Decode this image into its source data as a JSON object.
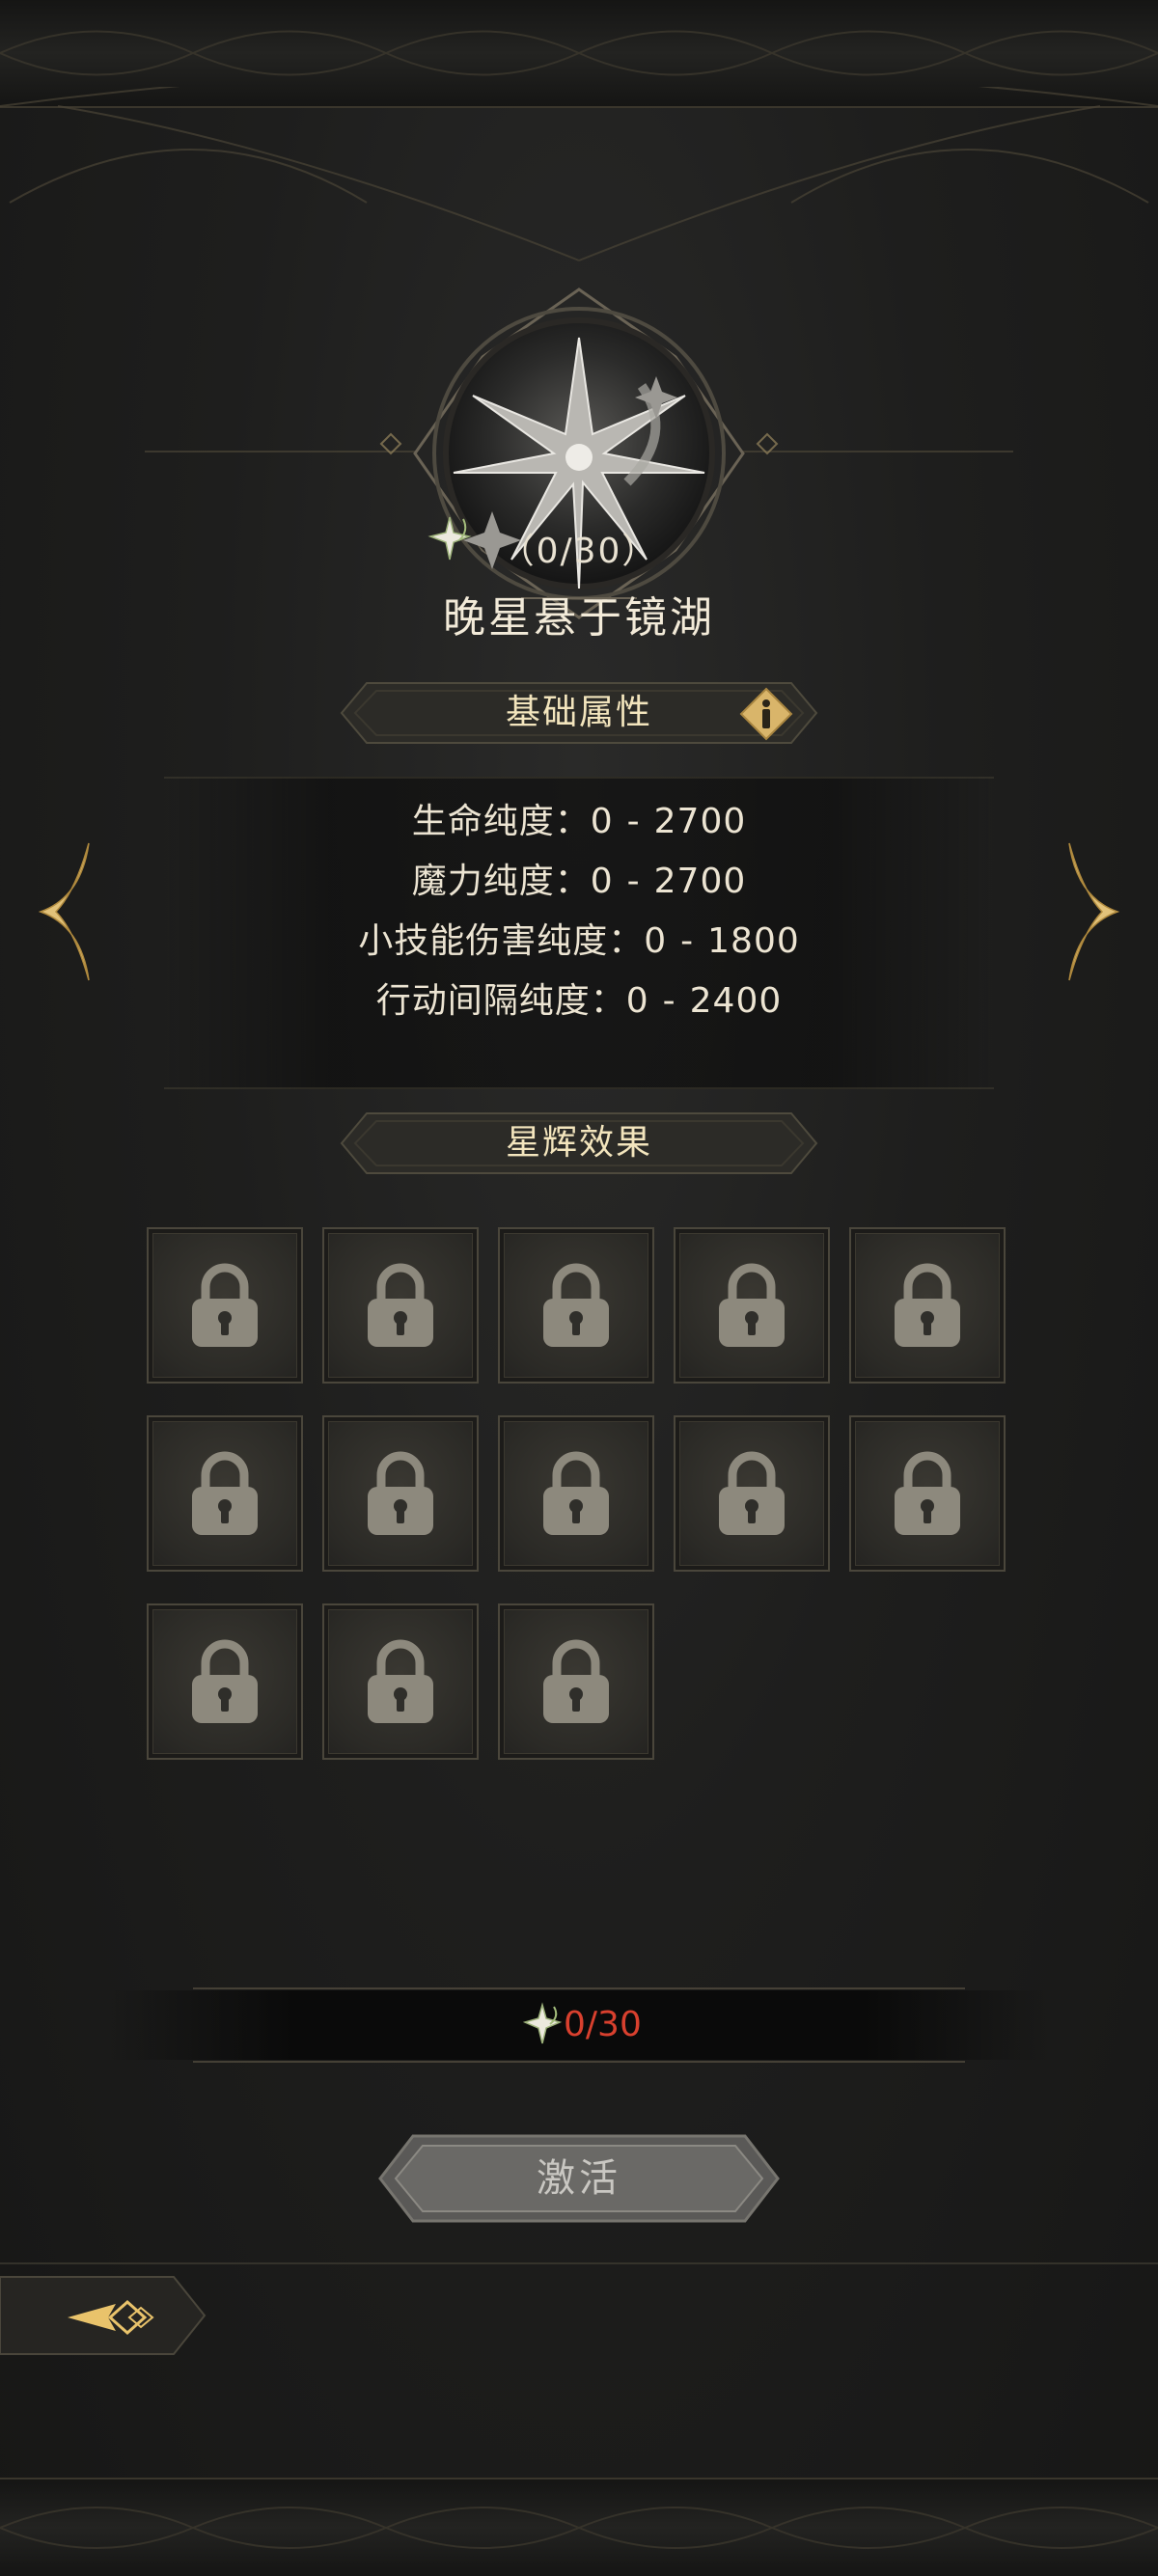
{
  "constellation": {
    "name": "晚星悬于镜湖",
    "progress_label": "（0/30）"
  },
  "basic_attributes": {
    "header": "基础属性",
    "info_icon": "info-icon",
    "stats": [
      {
        "label": "生命纯度：",
        "min": "0",
        "dash": "-",
        "max": "2700"
      },
      {
        "label": "魔力纯度：",
        "min": "0",
        "dash": "-",
        "max": "2700"
      },
      {
        "label": "小技能伤害纯度：",
        "min": "0",
        "dash": "-",
        "max": "1800"
      },
      {
        "label": "行动间隔纯度：",
        "min": "0",
        "dash": "-",
        "max": "2400"
      }
    ]
  },
  "star_effects": {
    "header": "星辉效果",
    "slots": [
      {
        "state": "locked",
        "icon": "lock-icon"
      },
      {
        "state": "locked",
        "icon": "lock-icon"
      },
      {
        "state": "locked",
        "icon": "lock-icon"
      },
      {
        "state": "locked",
        "icon": "lock-icon"
      },
      {
        "state": "locked",
        "icon": "lock-icon"
      },
      {
        "state": "locked",
        "icon": "lock-icon"
      },
      {
        "state": "locked",
        "icon": "lock-icon"
      },
      {
        "state": "locked",
        "icon": "lock-icon"
      },
      {
        "state": "locked",
        "icon": "lock-icon"
      },
      {
        "state": "locked",
        "icon": "lock-icon"
      },
      {
        "state": "locked",
        "icon": "lock-icon"
      },
      {
        "state": "locked",
        "icon": "lock-icon"
      },
      {
        "state": "locked",
        "icon": "lock-icon"
      }
    ]
  },
  "cost": {
    "text": "0/30",
    "color": "#d8402e",
    "icon": "star-fragment-icon"
  },
  "activate_button": {
    "label": "激活",
    "state": "disabled"
  },
  "navigation": {
    "prev_icon": "chevron-left-icon",
    "next_icon": "chevron-right-icon",
    "side_tab_icon": "compass-arrow-icon"
  },
  "colors": {
    "accent_gold": "#d9b56a",
    "text_cream": "#f3e5bd",
    "background": "#1b1b1b",
    "cost_red": "#d8402e"
  }
}
